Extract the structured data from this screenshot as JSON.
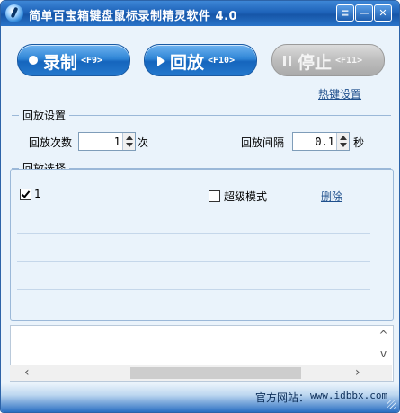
{
  "window": {
    "title": "简单百宝箱键盘鼠标录制精灵软件 4.0",
    "controls": {
      "menu": "≡",
      "minimize": "—",
      "close": "✕"
    }
  },
  "toolbar": {
    "record": {
      "label": "录制",
      "key": "<F9>",
      "icon": "record-dot-icon",
      "enabled": true
    },
    "playback": {
      "label": "回放",
      "key": "<F10>",
      "icon": "play-icon",
      "enabled": true
    },
    "stop": {
      "label": "停止",
      "key": "<F11>",
      "icon": "pause-icon",
      "enabled": false
    }
  },
  "hotkey_link": "热键设置",
  "playback_settings": {
    "title": "回放设置",
    "count_label": "回放次数",
    "count_value": "1",
    "count_unit": "次",
    "interval_label": "回放间隔",
    "interval_value": "0.1",
    "interval_unit": "秒"
  },
  "playback_select": {
    "title": "回放选择",
    "items": [
      {
        "label": "1",
        "checked": true
      }
    ],
    "super_mode_label": "超级模式",
    "super_mode_checked": false,
    "delete_label": "删除"
  },
  "scrollbar": {
    "left_arrow": "‹",
    "right_arrow": "›",
    "up_arrow": "^",
    "down_arrow": "v"
  },
  "footer": {
    "site_label": "官方网站：",
    "site_url": "www.idbbx.com"
  },
  "colors": {
    "title_bar": "#1e63b9",
    "button_active": "#2f85d6",
    "button_disabled": "#bdbdbd",
    "panel_bg": "#eaf3fb",
    "link": "#1e4f8c"
  }
}
